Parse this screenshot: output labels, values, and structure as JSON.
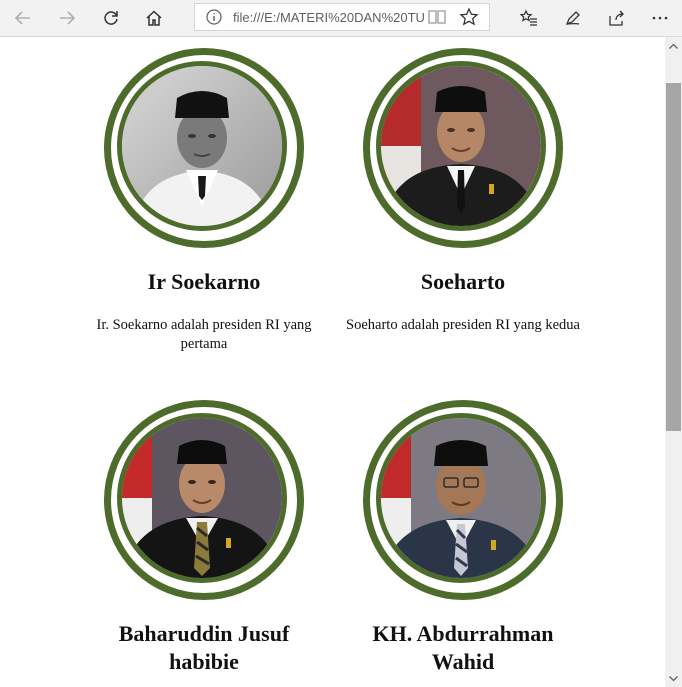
{
  "browser": {
    "address_url": "file:///E:/MATERI%20DAN%20TU",
    "icons": [
      "back-icon",
      "forward-icon",
      "refresh-icon",
      "home-icon",
      "info-icon",
      "reading-view-icon",
      "favorite-star-icon",
      "favorites-list-icon",
      "pen-icon",
      "share-icon",
      "more-icon"
    ]
  },
  "colors": {
    "frame_green": "#4d6b2a",
    "toolbar_bg": "#f2f2f2"
  },
  "presidents": [
    {
      "name": "Ir Soekarno",
      "description": "Ir. Soekarno adalah presiden RI yang pertama",
      "photo": "black-and-white portrait"
    },
    {
      "name": "Soeharto",
      "description": "Soeharto adalah presiden RI yang kedua",
      "photo": "color portrait with red-white flag"
    },
    {
      "name": "Baharuddin Jusuf habibie",
      "description": "",
      "photo": "color portrait with red-white flag"
    },
    {
      "name": "KH. Abdurrahman Wahid",
      "description": "",
      "photo": "color portrait with red-white flag"
    }
  ]
}
